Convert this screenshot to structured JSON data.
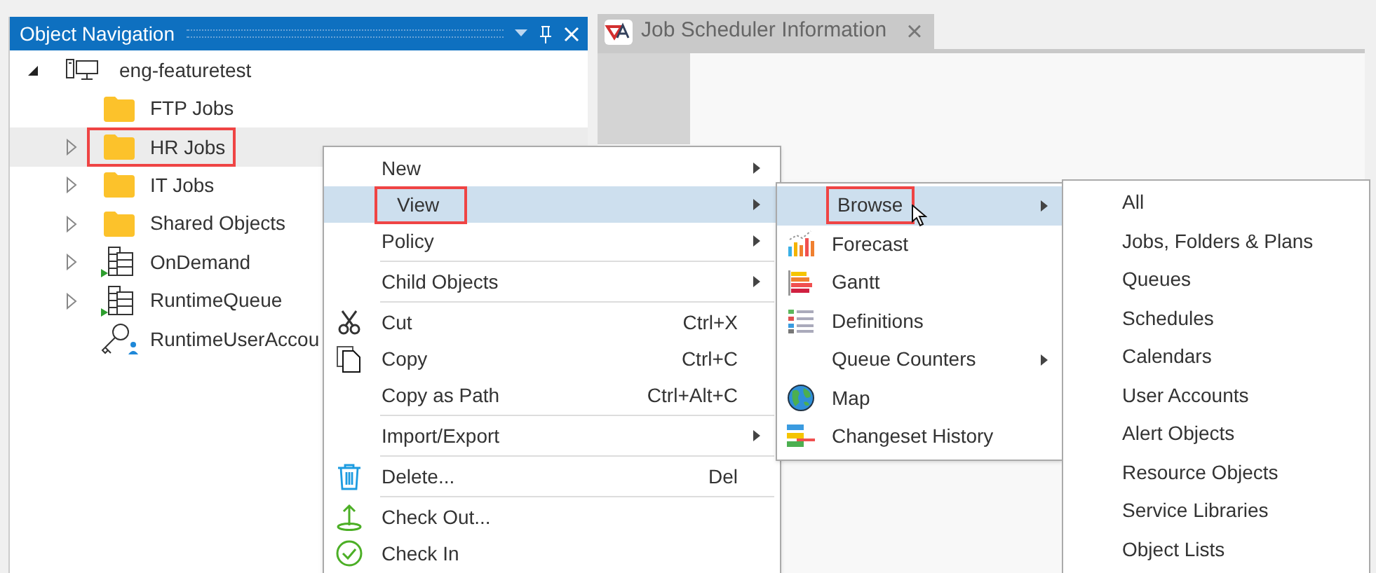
{
  "panel": {
    "title": "Object Navigation"
  },
  "tree": {
    "label": "eng-featuretest",
    "expanded": true,
    "children": [
      {
        "label": "FTP Jobs",
        "kind": "folder",
        "expandable": false,
        "selected": false,
        "outlined": false
      },
      {
        "label": "HR Jobs",
        "kind": "folder",
        "expandable": true,
        "selected": true,
        "outlined": true
      },
      {
        "label": "IT Jobs",
        "kind": "folder",
        "expandable": true,
        "selected": false,
        "outlined": false
      },
      {
        "label": "Shared Objects",
        "kind": "folder",
        "expandable": true,
        "selected": false,
        "outlined": false
      },
      {
        "label": "OnDemand",
        "kind": "queue",
        "expandable": true,
        "selected": false,
        "outlined": false
      },
      {
        "label": "RuntimeQueue",
        "kind": "queue",
        "expandable": true,
        "selected": false,
        "outlined": false
      },
      {
        "label": "RuntimeUserAccou",
        "kind": "account",
        "expandable": false,
        "selected": false,
        "outlined": false
      }
    ]
  },
  "tab": {
    "label": "Job Scheduler Information",
    "close": "×"
  },
  "context_menu": [
    {
      "kind": "item",
      "label": "New",
      "submenu": true,
      "selected": false,
      "outlined": false
    },
    {
      "kind": "item",
      "label": "View",
      "submenu": true,
      "selected": true,
      "outlined": true
    },
    {
      "kind": "item",
      "label": "Policy",
      "submenu": true,
      "selected": false,
      "outlined": false
    },
    {
      "kind": "separator"
    },
    {
      "kind": "item",
      "label": "Child Objects",
      "submenu": true,
      "selected": false,
      "outlined": false
    },
    {
      "kind": "separator"
    },
    {
      "kind": "item",
      "label": "Cut",
      "shortcut": "Ctrl+X",
      "submenu": false,
      "selected": false,
      "outlined": false
    },
    {
      "kind": "item",
      "label": "Copy",
      "shortcut": "Ctrl+C",
      "submenu": false,
      "selected": false,
      "outlined": false
    },
    {
      "kind": "item",
      "label": "Copy as Path",
      "shortcut": "Ctrl+Alt+C",
      "submenu": false,
      "selected": false,
      "outlined": false
    },
    {
      "kind": "separator"
    },
    {
      "kind": "item",
      "label": "Import/Export",
      "submenu": true,
      "selected": false,
      "outlined": false
    },
    {
      "kind": "separator"
    },
    {
      "kind": "item",
      "label": "Delete...",
      "shortcut": "Del",
      "submenu": false,
      "selected": false,
      "outlined": false
    },
    {
      "kind": "separator"
    },
    {
      "kind": "item",
      "label": "Check Out...",
      "submenu": false,
      "selected": false,
      "outlined": false
    },
    {
      "kind": "item",
      "label": "Check In",
      "submenu": false,
      "selected": false,
      "outlined": false
    }
  ],
  "view_menu": [
    {
      "label": "Browse",
      "submenu": true,
      "selected": true,
      "outlined": true
    },
    {
      "label": "Forecast",
      "submenu": false,
      "selected": false,
      "outlined": false
    },
    {
      "label": "Gantt",
      "submenu": false,
      "selected": false,
      "outlined": false
    },
    {
      "label": "Definitions",
      "submenu": false,
      "selected": false,
      "outlined": false
    },
    {
      "label": "Queue Counters",
      "submenu": true,
      "selected": false,
      "outlined": false
    },
    {
      "label": "Map",
      "submenu": false,
      "selected": false,
      "outlined": false
    },
    {
      "label": "Changeset History",
      "submenu": false,
      "selected": false,
      "outlined": false
    }
  ],
  "browse_menu": [
    "All",
    "Jobs, Folders & Plans",
    "Queues",
    "Schedules",
    "Calendars",
    "User Accounts",
    "Alert Objects",
    "Resource Objects",
    "Service Libraries",
    "Object Lists"
  ]
}
